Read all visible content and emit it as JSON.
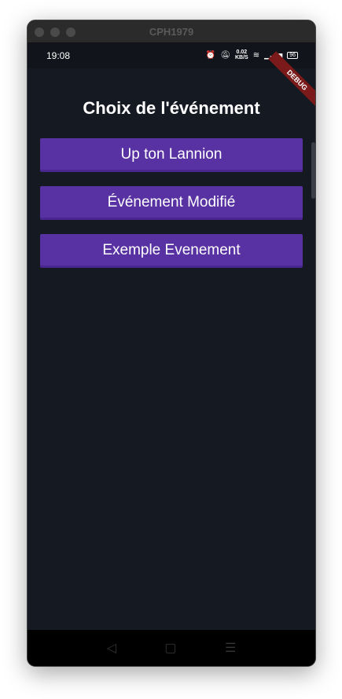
{
  "window": {
    "title": "CPH1979"
  },
  "status": {
    "time": "19:08",
    "net_speed": "0.02",
    "net_unit": "KB/S",
    "battery": "96",
    "debug_banner": "DEBUG"
  },
  "page": {
    "title": "Choix de l'événement",
    "events": [
      "Up ton Lannion",
      "Événement Modifié",
      "Exemple Evenement"
    ]
  },
  "nav": {
    "back": "◁",
    "home": "▢",
    "menu": "☰"
  }
}
